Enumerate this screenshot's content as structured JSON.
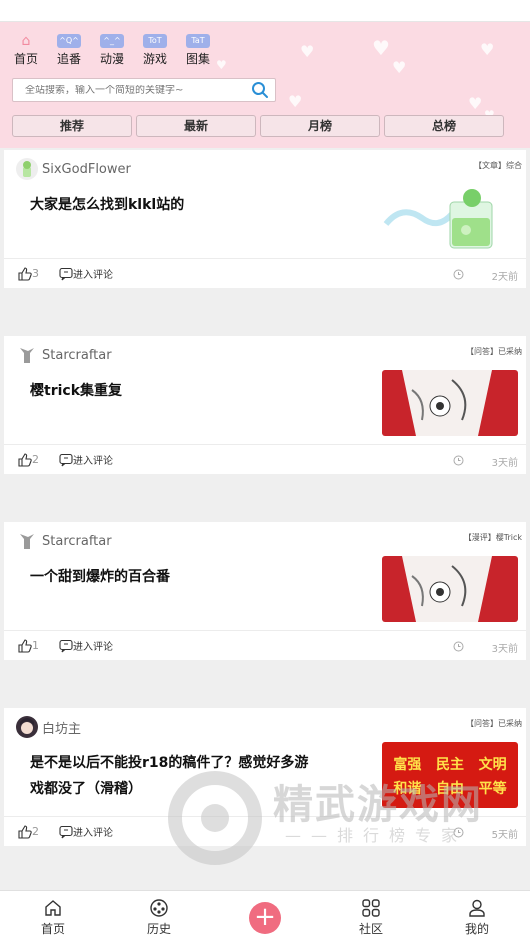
{
  "header": {
    "nav": [
      {
        "icon_text": "⌂",
        "label": "首页"
      },
      {
        "icon_text": "^Q^",
        "label": "追番"
      },
      {
        "icon_text": "^_^",
        "label": "动漫"
      },
      {
        "icon_text": "ToT",
        "label": "游戏"
      },
      {
        "icon_text": "TaT",
        "label": "图集"
      }
    ],
    "search_placeholder": "全站搜索，输入一个简短的关键字~",
    "tabs": [
      "推荐",
      "最新",
      "月榜",
      "总榜"
    ],
    "colors": {
      "background": "#fbdbe3",
      "accent": "#f06c80"
    }
  },
  "posts": [
    {
      "user": "SixGodFlower",
      "tag": "【文章】综合",
      "title": "大家是怎么找到klkl站的",
      "likes": "3",
      "comment_label": "进入评论",
      "time": "2天前"
    },
    {
      "user": "Starcraftar",
      "tag": "【问答】已采纳",
      "title": "樱trick集重复",
      "likes": "2",
      "comment_label": "进入评论",
      "time": "3天前"
    },
    {
      "user": "Starcraftar",
      "tag": "【漫评】樱Trick",
      "title": "一个甜到爆炸的百合番",
      "likes": "1",
      "comment_label": "进入评论",
      "time": "3天前"
    },
    {
      "user": "白坊主",
      "tag": "【问答】已采纳",
      "title": "是不是以后不能投r18的稿件了？感觉好多游戏都没了（滑稽）",
      "likes": "2",
      "comment_label": "进入评论",
      "time": "5天前"
    }
  ],
  "thumb_texts": [
    "富强",
    "民主",
    "文明",
    "和谐",
    "自由",
    "平等"
  ],
  "bottom_nav": [
    "首页",
    "历史",
    "社区",
    "我的"
  ],
  "watermark": {
    "title": "精武游戏网",
    "subtitle": "——排行榜专家"
  }
}
